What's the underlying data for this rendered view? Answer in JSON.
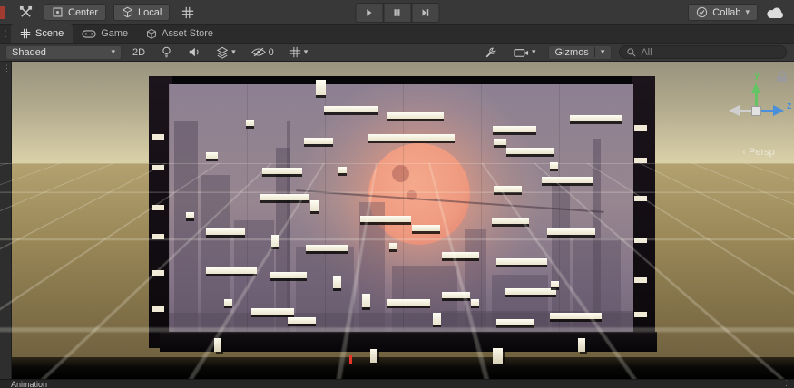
{
  "toolbar": {
    "center_label": "Center",
    "local_label": "Local",
    "collab_label": "Collab"
  },
  "tabs": [
    {
      "label": "Scene",
      "active": true
    },
    {
      "label": "Game",
      "active": false
    },
    {
      "label": "Asset Store",
      "active": false
    }
  ],
  "scene_toolbar": {
    "shading_mode": "Shaded",
    "mode_2d": "2D",
    "hidden_count": "0",
    "gizmos_label": "Gizmos",
    "search_value": "All"
  },
  "viewport": {
    "persp_label": "Persp",
    "axis_y_label": "y",
    "axis_z_label": "z",
    "colors": {
      "sun": "#ee9a80",
      "wall_top": "#8d8092",
      "wall_bottom": "#6e6173",
      "sky_top": "#99937f",
      "sky_horizon": "#ddd4ab",
      "ground_far": "#b3a170",
      "ground_near": "#6a5c3c",
      "axis_y": "#62c462",
      "axis_z": "#4a8fd9"
    }
  },
  "status_bar": {
    "animation_label": "Animation"
  },
  "scene": {
    "platforms": [
      [
        348,
        20,
        11,
        17
      ],
      [
        357,
        49,
        60,
        7
      ],
      [
        427,
        56,
        62,
        7
      ],
      [
        543,
        71,
        48,
        7
      ],
      [
        628,
        59,
        57,
        7
      ],
      [
        271,
        64,
        9,
        7
      ],
      [
        335,
        84,
        32,
        7
      ],
      [
        405,
        80,
        96,
        7
      ],
      [
        544,
        85,
        14,
        7
      ],
      [
        558,
        95,
        52,
        7
      ],
      [
        227,
        100,
        13,
        7
      ],
      [
        289,
        117,
        44,
        7
      ],
      [
        373,
        116,
        9,
        7
      ],
      [
        606,
        111,
        9,
        7
      ],
      [
        597,
        127,
        57,
        7
      ],
      [
        544,
        137,
        31,
        7
      ],
      [
        287,
        146,
        53,
        7
      ],
      [
        342,
        153,
        9,
        12
      ],
      [
        397,
        170,
        56,
        7
      ],
      [
        454,
        180,
        31,
        7
      ],
      [
        542,
        172,
        41,
        7
      ],
      [
        603,
        184,
        53,
        7
      ],
      [
        227,
        184,
        43,
        7
      ],
      [
        205,
        166,
        9,
        7
      ],
      [
        299,
        191,
        9,
        13
      ],
      [
        337,
        202,
        47,
        7
      ],
      [
        429,
        200,
        9,
        7
      ],
      [
        487,
        210,
        41,
        7
      ],
      [
        547,
        217,
        56,
        7
      ],
      [
        227,
        227,
        56,
        7
      ],
      [
        297,
        232,
        41,
        7
      ],
      [
        367,
        237,
        9,
        13
      ],
      [
        399,
        256,
        9,
        15
      ],
      [
        427,
        262,
        47,
        7
      ],
      [
        487,
        254,
        31,
        7
      ],
      [
        519,
        262,
        9,
        7
      ],
      [
        557,
        250,
        56,
        7
      ],
      [
        607,
        242,
        9,
        7
      ],
      [
        247,
        262,
        9,
        7
      ],
      [
        277,
        272,
        47,
        7
      ],
      [
        317,
        282,
        31,
        7
      ],
      [
        477,
        277,
        9,
        13
      ],
      [
        547,
        284,
        41,
        7
      ],
      [
        606,
        277,
        57,
        7
      ]
    ],
    "pillars": [
      [
        236,
        305,
        8,
        15
      ],
      [
        408,
        317,
        8,
        15
      ],
      [
        543,
        316,
        11,
        17
      ],
      [
        637,
        305,
        8,
        15
      ]
    ],
    "left_notches": [
      [
        168,
        80,
        13,
        6
      ],
      [
        168,
        114,
        13,
        6
      ],
      [
        168,
        158,
        13,
        6
      ],
      [
        168,
        190,
        13,
        6
      ],
      [
        168,
        230,
        13,
        6
      ],
      [
        168,
        270,
        13,
        6
      ]
    ],
    "right_notches": [
      [
        699,
        70,
        14,
        6
      ],
      [
        699,
        106,
        14,
        6
      ],
      [
        699,
        148,
        14,
        6
      ],
      [
        699,
        194,
        14,
        6
      ],
      [
        699,
        238,
        14,
        6
      ],
      [
        699,
        276,
        14,
        6
      ]
    ],
    "buildings": [
      [
        6,
        40,
        26,
        252,
        0.5
      ],
      [
        36,
        100,
        32,
        192,
        0.45
      ],
      [
        72,
        150,
        44,
        142,
        0.4
      ],
      [
        118,
        70,
        16,
        222,
        0.5
      ],
      [
        130,
        40,
        4,
        252,
        0.45
      ],
      [
        140,
        180,
        64,
        112,
        0.38
      ],
      [
        210,
        130,
        28,
        162,
        0.35
      ],
      [
        246,
        200,
        72,
        92,
        0.4
      ],
      [
        326,
        160,
        24,
        132,
        0.35
      ],
      [
        356,
        210,
        62,
        82,
        0.4
      ],
      [
        422,
        110,
        20,
        182,
        0.45
      ],
      [
        446,
        170,
        52,
        122,
        0.4
      ],
      [
        468,
        60,
        8,
        232,
        0.5
      ],
      [
        300,
        250,
        212,
        42,
        0.5
      ],
      [
        0,
        252,
        512,
        40,
        0.45
      ]
    ],
    "marker": [
      385,
      324,
      3,
      10
    ],
    "marker_color": "#e8352a"
  }
}
